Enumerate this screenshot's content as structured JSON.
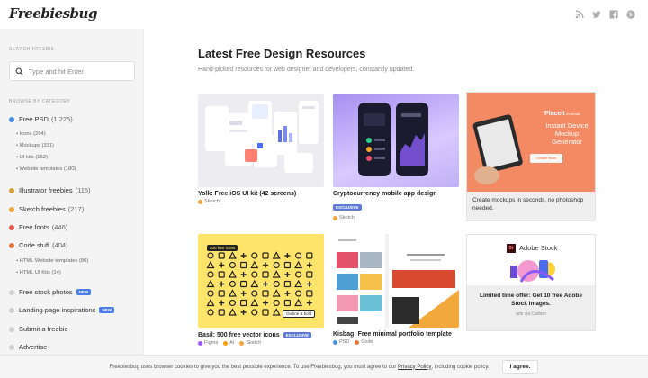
{
  "header": {
    "logo": "Freebiesbug",
    "social": [
      "rss-icon",
      "twitter-icon",
      "facebook-icon",
      "pinterest-icon"
    ]
  },
  "sidebar": {
    "search_title": "SEARCH FREEBIE",
    "search_placeholder": "Type and hit Enter",
    "category_title": "BROWSE BY CATEGORY",
    "categories": [
      {
        "label": "Free PSD",
        "count": "(1,225)",
        "color": "#4a90e2",
        "subs": [
          "Icons (294)",
          "Mockups (331)",
          "UI kits (152)",
          "Website templates (180)"
        ]
      },
      {
        "label": "Illustrator freebies",
        "count": "(115)",
        "color": "#d4a23a"
      },
      {
        "label": "Sketch freebies",
        "count": "(217)",
        "color": "#f0a63a"
      },
      {
        "label": "Free fonts",
        "count": "(446)",
        "color": "#e0574b"
      },
      {
        "label": "Code stuff",
        "count": "(404)",
        "color": "#e07a3a",
        "subs": [
          "HTML Website templates (86)",
          "HTML UI Kits (14)"
        ]
      },
      {
        "label": "Free stock photos",
        "badge": "NEW",
        "color": "#cfcfcf"
      },
      {
        "label": "Landing page inspirations",
        "badge": "NEW",
        "color": "#cfcfcf"
      },
      {
        "label": "Submit a freebie",
        "color": "#cfcfcf"
      },
      {
        "label": "Advertise",
        "color": "#cfcfcf"
      }
    ]
  },
  "main": {
    "title": "Latest Free Design Resources",
    "subtitle": "Hand-picked resources for web designer and developers, constantly updated."
  },
  "cards": [
    {
      "title": "Yolk: Free iOS UI kit (42 screens)",
      "tags": [
        "Sketch"
      ]
    },
    {
      "title": "Cryptocurrency mobile app design",
      "exclusive": "EXCLUSIVE",
      "tags": [
        "Sketch"
      ]
    },
    {
      "title": "Create mockups in seconds, no photoshop needed.",
      "promo_brand": "Placeit",
      "promo_brand_sub": "by envato",
      "promo_headline": "Instant Device Mockup Generator",
      "promo_cta": "Create Now"
    },
    {
      "title": "Basil: 500 free vector icons",
      "exclusive": "EXCLUSIVE",
      "tags": [
        "Figma",
        "AI",
        "Sketch"
      ],
      "thumb_top": "500 free icons",
      "thumb_bottom": "Outline & bold"
    },
    {
      "title": "Kisbag: Free minimal portfolio template",
      "tags": [
        "PSD",
        "Code"
      ]
    },
    {
      "title": "Limited time offer: Get 10 free Adobe Stock images.",
      "promo_brand": "Adobe Stock",
      "ad_note": "ads via Carbon"
    }
  ],
  "cookie": {
    "text": "Freebiesbug uses browser cookies to give you the best possible experience. To use Freebiesbug, you must agree to our",
    "link": "Privacy Policy",
    "suffix": ", including cookie policy.",
    "button": "I agree."
  }
}
